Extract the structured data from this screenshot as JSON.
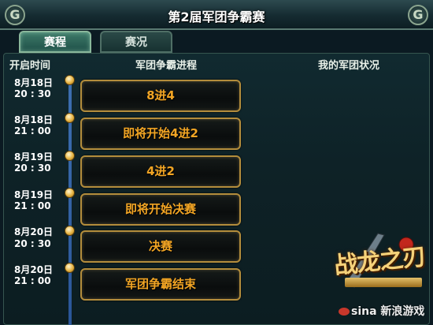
{
  "window": {
    "title": "第2届军团争霸赛"
  },
  "tabs": [
    {
      "label": "赛程",
      "active": true
    },
    {
      "label": "赛况",
      "active": false
    }
  ],
  "columns": {
    "time": "开启时间",
    "progress": "军团争霸进程",
    "status": "我的军团状况"
  },
  "schedule": [
    {
      "date": "8月18日",
      "time": "20 : 30",
      "stage": "8进4"
    },
    {
      "date": "8月18日",
      "time": "21 : 00",
      "stage": "即将开始4进2"
    },
    {
      "date": "8月19日",
      "time": "20 : 30",
      "stage": "4进2"
    },
    {
      "date": "8月19日",
      "time": "21 : 00",
      "stage": "即将开始决赛"
    },
    {
      "date": "8月20日",
      "time": "20 : 30",
      "stage": "决赛"
    },
    {
      "date": "8月20日",
      "time": "21 : 00",
      "stage": "军团争霸结束"
    }
  ],
  "logo": {
    "text": "战龙之刃",
    "icon": "game-logo-icon"
  },
  "watermark": {
    "text": "新浪游戏",
    "brand": "sina",
    "icon": "sina-eye-icon"
  },
  "colors": {
    "stage_text": "#f2a524",
    "stage_border": "#b38d3c",
    "rail": "#3d6fb0",
    "tab_active": "#3e7a69"
  }
}
